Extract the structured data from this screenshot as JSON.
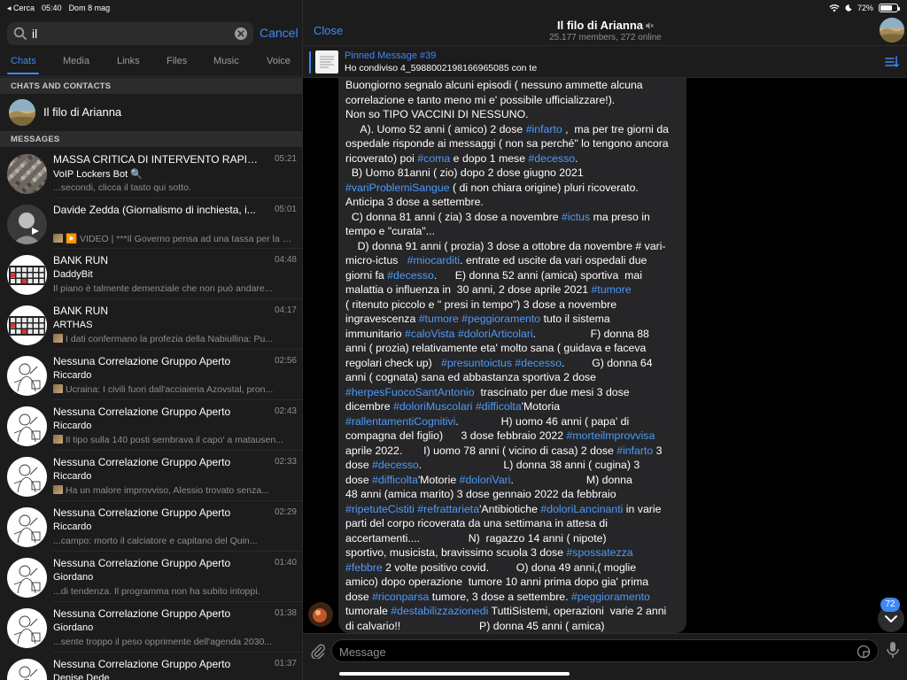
{
  "status_bar": {
    "back_label": "◂ Cerca",
    "time": "05:40",
    "date": "Dom 8 mag",
    "battery_percent": "72%",
    "battery_level": 0.72
  },
  "search": {
    "value": "il",
    "placeholder": "Search",
    "cancel_label": "Cancel"
  },
  "tabs": [
    {
      "label": "Chats",
      "active": true
    },
    {
      "label": "Media"
    },
    {
      "label": "Links"
    },
    {
      "label": "Files"
    },
    {
      "label": "Music"
    },
    {
      "label": "Voice"
    }
  ],
  "sections": {
    "contacts": "CHATS AND CONTACTS",
    "messages": "MESSAGES"
  },
  "contact": {
    "name": "Il filo di Arianna"
  },
  "messages": [
    {
      "title": "MASSA CRITICA DI INTERVENTO RAPIDO",
      "time": "05:21",
      "sender": "VoIP Lockers Bot 🔍",
      "preview": "...secondi, clicca il tasto qui sotto.",
      "avatar": "crowd"
    },
    {
      "title": "Davide Zedda (Giornalismo di inchiesta, i...",
      "time": "05:01",
      "sender": "",
      "preview": "▶️ VIDEO | ***Il Governo pensa ad una tassa per la guerra Ucraina*** (Davide Zedda) Sostieni il canale...",
      "avatar": "person"
    },
    {
      "title": "BANK RUN",
      "time": "04:48",
      "sender": "DaddyBit",
      "preview": "Il piano è talmente demenziale che non può andare...",
      "avatar": "keyboard"
    },
    {
      "title": "BANK RUN",
      "time": "04:17",
      "sender": "ARTHAS",
      "preview": "I dati confermano la profezia della Nabiullina: Pu...",
      "avatar": "keyboard"
    },
    {
      "title": "Nessuna Correlazione Gruppo Aperto",
      "time": "02:56",
      "sender": "Riccardo",
      "preview": "Ucraina: I civili fuori dall'acciaieria Azovstal, pron...",
      "avatar": "sketch"
    },
    {
      "title": "Nessuna Correlazione Gruppo Aperto",
      "time": "02:43",
      "sender": "Riccardo",
      "preview": "Il tipo sulla 140 posti sembrava il capo' a matausen...",
      "avatar": "sketch"
    },
    {
      "title": "Nessuna Correlazione Gruppo Aperto",
      "time": "02:33",
      "sender": "Riccardo",
      "preview": "Ha un malore improvviso, Alessio trovato senza...",
      "avatar": "sketch"
    },
    {
      "title": "Nessuna Correlazione Gruppo Aperto",
      "time": "02:29",
      "sender": "Riccardo",
      "preview": "...campo: morto il calciatore e capitano del Quin...",
      "avatar": "sketch"
    },
    {
      "title": "Nessuna Correlazione Gruppo Aperto",
      "time": "01:40",
      "sender": "Giordano",
      "preview": "...di tendenza. Il programma non ha subito intoppi.",
      "avatar": "sketch"
    },
    {
      "title": "Nessuna Correlazione Gruppo Aperto",
      "time": "01:38",
      "sender": "Giordano",
      "preview": "...sente troppo il peso opprimente dell'agenda 2030...",
      "avatar": "sketch"
    },
    {
      "title": "Nessuna Correlazione Gruppo Aperto",
      "time": "01:37",
      "sender": "Denise Dede",
      "preview": "",
      "avatar": "sketch"
    }
  ],
  "chat": {
    "close_label": "Close",
    "title": "Il filo di Arianna",
    "subtitle": "25.177 members, 272 online",
    "pinned_title": "Pinned Message #39",
    "pinned_text": "Ho condiviso 4_5988002198166965085 con te",
    "input_placeholder": "Message",
    "unread_count": "72",
    "message_lines": [
      [
        {
          "t": "Buongiorno segnalo alcuni episodi ( nessuno ammette alcuna"
        }
      ],
      [
        {
          "t": "correlazione e tanto meno mi e' possibile ufficializzare!)."
        }
      ],
      [
        {
          "t": "Non so TIPO VACCINI DI NESSUNO."
        }
      ],
      [
        {
          "t": "     A). Uomo 52 anni ( amico) 2 dose "
        },
        {
          "t": "#infarto",
          "h": 1
        },
        {
          "t": " ,  ma per tre giorni da"
        }
      ],
      [
        {
          "t": "ospedale risponde ai messaggi ( non sa perché\" lo tengono ancora"
        }
      ],
      [
        {
          "t": "ricoverato) poi "
        },
        {
          "t": "#coma",
          "h": 1
        },
        {
          "t": " e dopo 1 mese "
        },
        {
          "t": "#decesso",
          "h": 1
        },
        {
          "t": "."
        }
      ],
      [
        {
          "t": "  B) Uomo 81anni ( zio) dopo 2 dose giugno 2021"
        }
      ],
      [
        {
          "t": "#variProblemiSangue",
          "h": 1
        },
        {
          "t": " ( di non chiara origine) pluri ricoverato."
        }
      ],
      [
        {
          "t": "Anticipa 3 dose a settembre."
        }
      ],
      [
        {
          "t": "  C) donna 81 anni ( zia) 3 dose a novembre "
        },
        {
          "t": "#ictus",
          "h": 1
        },
        {
          "t": " ma preso in"
        }
      ],
      [
        {
          "t": "tempo e \"curata\"..."
        }
      ],
      [
        {
          "t": "    D) donna 91 anni ( prozia) 3 dose a ottobre da novembre # vari-"
        }
      ],
      [
        {
          "t": "micro-ictus   "
        },
        {
          "t": "#miocarditi",
          "h": 1
        },
        {
          "t": ". entrate ed uscite da vari ospedali due"
        }
      ],
      [
        {
          "t": "giorni fa "
        },
        {
          "t": "#decesso",
          "h": 1
        },
        {
          "t": ".      E) donna 52 anni (amica) sportiva  mai"
        }
      ],
      [
        {
          "t": "malattia o influenza in  30 anni, 2 dose aprile 2021 "
        },
        {
          "t": "#tumore",
          "h": 1
        }
      ],
      [
        {
          "t": "( ritenuto piccolo e \" presi in tempo\") 3 dose a novembre"
        }
      ],
      [
        {
          "t": "ingravescenza "
        },
        {
          "t": "#tumore",
          "h": 1
        },
        {
          "t": " "
        },
        {
          "t": "#peggioramento",
          "h": 1
        },
        {
          "t": " tuto il sistema"
        }
      ],
      [
        {
          "t": "immunitario "
        },
        {
          "t": "#caloVista",
          "h": 1
        },
        {
          "t": " "
        },
        {
          "t": "#doloriArticolari",
          "h": 1
        },
        {
          "t": ".                  F) donna 88"
        }
      ],
      [
        {
          "t": "anni ( prozia) relativamente eta' molto sana ( guidava e faceva"
        }
      ],
      [
        {
          "t": "regolari check up)   "
        },
        {
          "t": "#presuntoictus",
          "h": 1
        },
        {
          "t": " "
        },
        {
          "t": "#decesso",
          "h": 1
        },
        {
          "t": ".         G) donna 64"
        }
      ],
      [
        {
          "t": "anni ( cognata) sana ed abbastanza sportiva 2 dose"
        }
      ],
      [
        {
          "t": "#herpesFuocoSantAntonio",
          "h": 1
        },
        {
          "t": "  trascinato per due mesi 3 dose"
        }
      ],
      [
        {
          "t": "dicembre "
        },
        {
          "t": "#doloriMuscolari",
          "h": 1
        },
        {
          "t": " "
        },
        {
          "t": "#difficolta",
          "h": 1
        },
        {
          "t": "'Motoria"
        }
      ],
      [
        {
          "t": "#rallentamentiCognitivi",
          "h": 1
        },
        {
          "t": ".              H) uomo 46 anni ( papa' di"
        }
      ],
      [
        {
          "t": "compagna del figlio)      3 dose febbraio 2022 "
        },
        {
          "t": "#morteilmprovvisa",
          "h": 1
        }
      ],
      [
        {
          "t": "aprile 2022.       I) uomo 78 anni ( vicino di casa) 2 dose "
        },
        {
          "t": "#infarto",
          "h": 1
        },
        {
          "t": " 3"
        }
      ],
      [
        {
          "t": "dose "
        },
        {
          "t": "#decesso",
          "h": 1
        },
        {
          "t": ".                           L) donna 38 anni ( cugina) 3"
        }
      ],
      [
        {
          "t": "dose "
        },
        {
          "t": "#difficolta",
          "h": 1
        },
        {
          "t": "'Motorie "
        },
        {
          "t": "#doloriVari",
          "h": 1
        },
        {
          "t": ".                        M) donna"
        }
      ],
      [
        {
          "t": "48 anni (amica marito) 3 dose gennaio 2022 da febbraio"
        }
      ],
      [
        {
          "t": "#ripetuteCistiti",
          "h": 1
        },
        {
          "t": " "
        },
        {
          "t": "#refrattarieta",
          "h": 1
        },
        {
          "t": "'Antibiotiche "
        },
        {
          "t": "#doloriLancinanti",
          "h": 1
        },
        {
          "t": " in varie"
        }
      ],
      [
        {
          "t": "parti del corpo ricoverata da una settimana in attesa di"
        }
      ],
      [
        {
          "t": "accertamenti....                N)  ragazzo 14 anni ( nipote)"
        }
      ],
      [
        {
          "t": "sportivo, musicista, bravissimo scuola 3 dose "
        },
        {
          "t": "#spossatezza",
          "h": 1
        }
      ],
      [
        {
          "t": "#febbre",
          "h": 1
        },
        {
          "t": " 2 volte positivo covid.         O) dona 49 anni,( moglie"
        }
      ],
      [
        {
          "t": "amico) dopo operazione  tumore 10 anni prima dopo gia' prima"
        }
      ],
      [
        {
          "t": "dose "
        },
        {
          "t": "#riconparsa",
          "h": 1
        },
        {
          "t": " tumore, 3 dose a settembre. "
        },
        {
          "t": "#peggioramento",
          "h": 1
        }
      ],
      [
        {
          "t": "tumorale "
        },
        {
          "t": "#destabilizzazionedi",
          "h": 1
        },
        {
          "t": " TuttiSistemi, operazioni  varie 2 anni"
        }
      ],
      [
        {
          "t": "di calvario!!                          P) donna 45 anni ( amica)"
        }
      ]
    ]
  },
  "colors": {
    "accent": "#3e88f7",
    "hashtag": "#4d9bf9",
    "panel": "#1c1c1d",
    "bubble": "#262628"
  }
}
